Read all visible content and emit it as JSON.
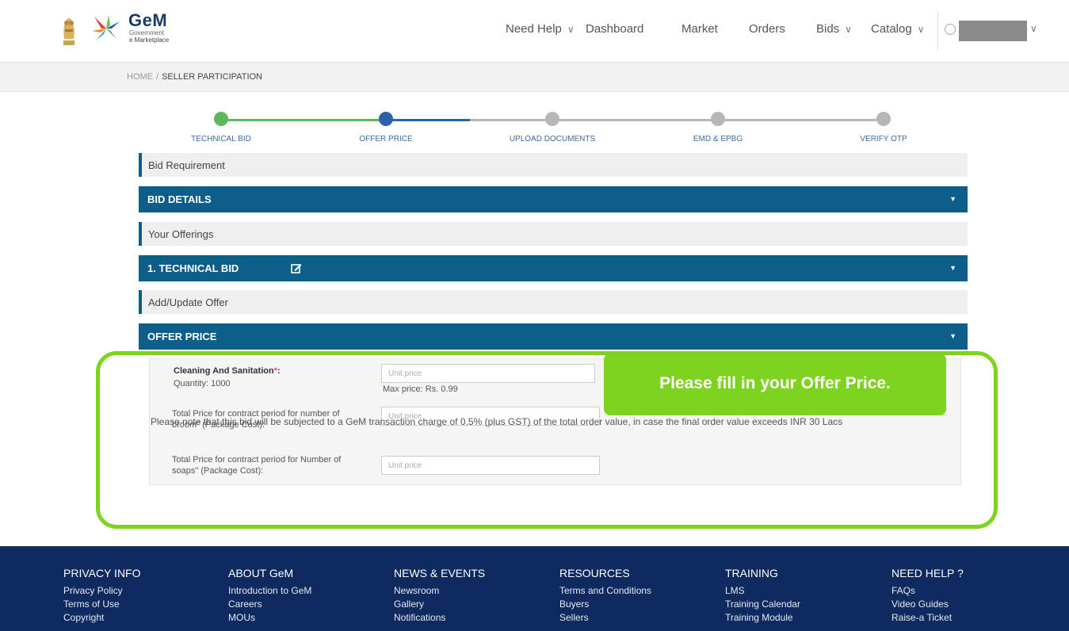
{
  "header": {
    "logo_word": "GeM",
    "logo_sub1": "Government",
    "logo_sub2": "e Marketplace",
    "nav": [
      {
        "label": "Need Help",
        "dropdown": true
      },
      {
        "label": "Dashboard",
        "dropdown": false
      },
      {
        "label": "Market",
        "dropdown": false
      },
      {
        "label": "Orders",
        "dropdown": false
      },
      {
        "label": "Bids",
        "dropdown": true
      },
      {
        "label": "Catalog",
        "dropdown": true
      }
    ],
    "dropdown_glyph": "∨"
  },
  "breadcrumb": {
    "home": "HOME",
    "sep": "/",
    "current": "SELLER PARTICIPATION"
  },
  "stepper": {
    "steps": [
      {
        "label": "TECHNICAL BID",
        "state": "done"
      },
      {
        "label": "OFFER PRICE",
        "state": "active"
      },
      {
        "label": "UPLOAD DOCUMENTS",
        "state": "pending"
      },
      {
        "label": "EMD & EPBG",
        "state": "pending"
      },
      {
        "label": "VERIFY OTP",
        "state": "pending"
      }
    ],
    "colors": {
      "done": "#5cb85c",
      "active": "#2a63a8",
      "pending": "#b7b7b7"
    }
  },
  "sections": {
    "bid_requirement": "Bid Requirement",
    "bid_details": "BID DETAILS",
    "your_offerings": "Your Offerings",
    "technical_bid": "1. TECHNICAL BID",
    "add_update_offer": "Add/Update Offer",
    "offer_price": "OFFER PRICE",
    "caret": "▼"
  },
  "offer_form": {
    "item_name": "Cleaning And Sanitation",
    "required_mark": "*",
    "item_colon": ":",
    "quantity": "Quantity: 1000",
    "unit_placeholder": "Unit price",
    "max_price": "Max price: Rs. 0.99",
    "broom_label": "Total Price for contract period for number of broom\" (Package Cost):",
    "soaps_label": "Total Price for contract period for Number of soaps\" (Package Cost):"
  },
  "note": "Please note that this bid will be subjected to a GeM transaction charge of 0.5% (plus GST) of the total order value, in case the final order value exceeds INR 30 Lacs",
  "tutorial": {
    "message": "Please fill in your Offer Price.",
    "color": "#7ed321"
  },
  "footer": {
    "columns": [
      {
        "title": "PRIVACY INFO",
        "links": [
          "Privacy Policy",
          "Terms of Use",
          "Copyright"
        ]
      },
      {
        "title": "ABOUT GeM",
        "links": [
          "Introduction to GeM",
          "Careers",
          "MOUs"
        ]
      },
      {
        "title": "NEWS & EVENTS",
        "links": [
          "Newsroom",
          "Gallery",
          "Notifications"
        ]
      },
      {
        "title": "RESOURCES",
        "links": [
          "Terms and Conditions",
          "Buyers",
          "Sellers"
        ]
      },
      {
        "title": "TRAINING",
        "links": [
          "LMS",
          "Training Calendar",
          "Training Module"
        ]
      },
      {
        "title": "NEED HELP ?",
        "links": [
          "FAQs",
          "Video Guides",
          "Raise-a Ticket"
        ]
      }
    ]
  }
}
